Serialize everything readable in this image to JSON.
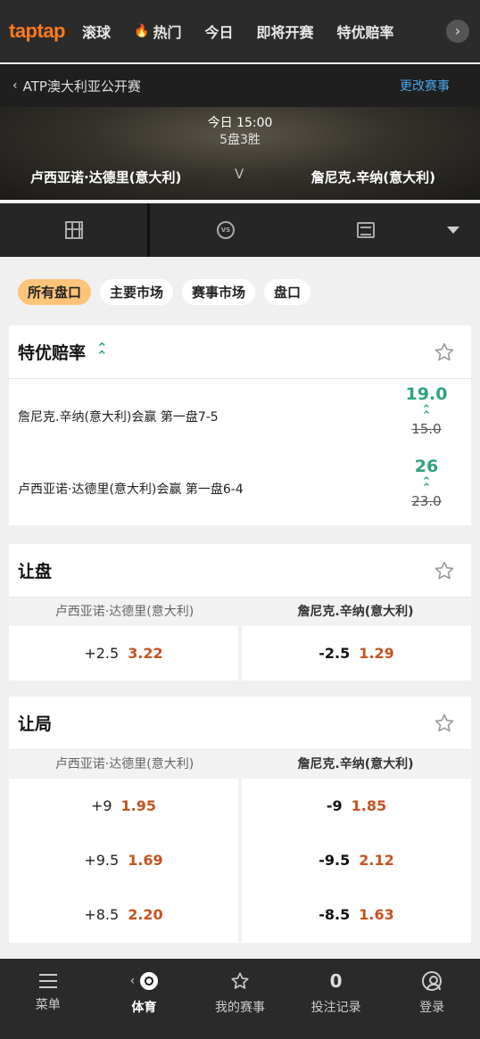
{
  "nav": {
    "logo": "taptap",
    "items": [
      {
        "label": "滚球"
      },
      {
        "label": "热门",
        "icon": "fire-icon"
      },
      {
        "label": "今日"
      },
      {
        "label": "即将开赛"
      },
      {
        "label": "特优赔率"
      }
    ],
    "next_icon": "›"
  },
  "event": {
    "back_icon": "‹",
    "name": "ATP澳大利亚公开赛",
    "change_label": "更改赛事"
  },
  "match": {
    "time": "今日 15:00",
    "format": "5盘3胜",
    "team1": "卢西亚诺·达德里(意大利)",
    "vs": "V",
    "team2": "詹尼克.辛纳(意大利)"
  },
  "view_tabs": {
    "vs_icon_text": "VS"
  },
  "filters": [
    {
      "label": "所有盘口",
      "active": true
    },
    {
      "label": "主要市场",
      "active": false
    },
    {
      "label": "赛事市场",
      "active": false
    },
    {
      "label": "盘口",
      "active": false
    }
  ],
  "special_odds": {
    "title": "特优赔率",
    "boost_icon": "«",
    "rows": [
      {
        "label": "詹尼克.辛纳(意大利)会赢 第一盘7-5",
        "new_odds": "19.0",
        "old_odds": "15.0"
      },
      {
        "label": "卢西亚诺·达德里(意大利)会赢 第一盘6-4",
        "new_odds": "26",
        "old_odds": "23.0"
      }
    ]
  },
  "handicap": {
    "title": "让盘",
    "col1": "卢西亚诺·达德里(意大利)",
    "col2": "詹尼克.辛纳(意大利)",
    "left": [
      {
        "line": "+2.5",
        "odds": "3.22"
      }
    ],
    "right": [
      {
        "line": "-2.5",
        "odds": "1.29"
      }
    ]
  },
  "game_handicap": {
    "title": "让局",
    "col1": "卢西亚诺·达德里(意大利)",
    "col2": "詹尼克.辛纳(意大利)",
    "left": [
      {
        "line": "+9",
        "odds": "1.95"
      },
      {
        "line": "+9.5",
        "odds": "1.69"
      },
      {
        "line": "+8.5",
        "odds": "2.20"
      }
    ],
    "right": [
      {
        "line": "-9",
        "odds": "1.85"
      },
      {
        "line": "-9.5",
        "odds": "2.12"
      },
      {
        "line": "-8.5",
        "odds": "1.63"
      }
    ]
  },
  "bottom": {
    "menu": "菜单",
    "sports_back_icon": "‹",
    "sports": "体育",
    "my_events": "我的赛事",
    "bets_count": "0",
    "bet_record": "投注记录",
    "login": "登录"
  },
  "colors": {
    "accent": "#ff7a1a",
    "boost_green": "#2fa37a",
    "odds_orange": "#c8521e",
    "chip_active": "#ffc47a",
    "link_blue": "#4aa3e8"
  }
}
